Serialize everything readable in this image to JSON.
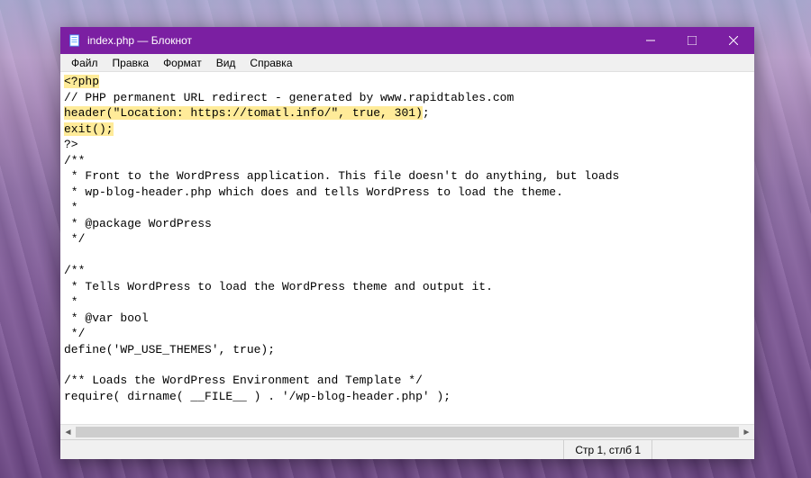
{
  "window": {
    "title": "index.php — Блокнот"
  },
  "menu": {
    "file": "Файл",
    "edit": "Правка",
    "format": "Формат",
    "view": "Вид",
    "help": "Справка"
  },
  "code": {
    "lines": [
      {
        "text": "<?php",
        "highlight": true
      },
      {
        "text": "// PHP permanent URL redirect - generated by www.rapidtables.com",
        "highlight": false
      },
      {
        "text": "header(\"Location: https://tomatl.info/\", true, 301)",
        "highlight": true,
        "suffix": ";"
      },
      {
        "text": "exit();",
        "highlight": true
      },
      {
        "text": "?>",
        "highlight": false
      },
      {
        "text": "/**",
        "highlight": false
      },
      {
        "text": " * Front to the WordPress application. This file doesn't do anything, but loads",
        "highlight": false
      },
      {
        "text": " * wp-blog-header.php which does and tells WordPress to load the theme.",
        "highlight": false
      },
      {
        "text": " *",
        "highlight": false
      },
      {
        "text": " * @package WordPress",
        "highlight": false
      },
      {
        "text": " */",
        "highlight": false
      },
      {
        "text": "",
        "highlight": false
      },
      {
        "text": "/**",
        "highlight": false
      },
      {
        "text": " * Tells WordPress to load the WordPress theme and output it.",
        "highlight": false
      },
      {
        "text": " *",
        "highlight": false
      },
      {
        "text": " * @var bool",
        "highlight": false
      },
      {
        "text": " */",
        "highlight": false
      },
      {
        "text": "define('WP_USE_THEMES', true);",
        "highlight": false
      },
      {
        "text": "",
        "highlight": false
      },
      {
        "text": "/** Loads the WordPress Environment and Template */",
        "highlight": false
      },
      {
        "text": "require( dirname( __FILE__ ) . '/wp-blog-header.php' );",
        "highlight": false
      }
    ]
  },
  "statusbar": {
    "position": "Стр 1, стлб 1"
  }
}
